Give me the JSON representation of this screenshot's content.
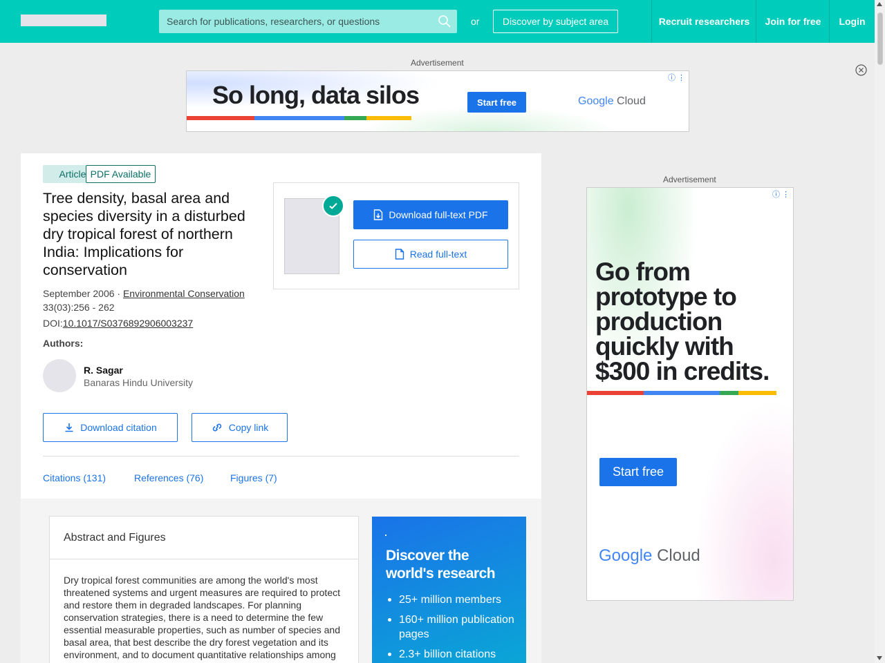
{
  "nav": {
    "search_placeholder": "Search for publications, researchers, or questions",
    "or_label": "or",
    "discover_label": "Discover by subject area",
    "links": [
      "Recruit researchers",
      "Join for free",
      "Login"
    ]
  },
  "ads": {
    "label": "Advertisement",
    "banner": {
      "headline": "So long, data silos",
      "cta": "Start free",
      "brand_google": "Google",
      "brand_cloud": "Cloud"
    },
    "side": {
      "headline": "Go from prototype to production quickly with $300 in credits.",
      "cta": "Start free",
      "brand_google": "Google",
      "brand_cloud": "Cloud"
    }
  },
  "article": {
    "type_badge": "Article",
    "pdf_badge": "PDF Available",
    "title": "Tree density, basal area and species diversity in a disturbed dry tropical forest of northern India: Implications for conservation",
    "date": "September 2006 · ",
    "journal": "Environmental Conservation",
    "volume": "33(03):256 - 262",
    "doi_label": "DOI:",
    "doi": "10.1017/S0376892906003237",
    "authors_label": "Authors:",
    "authors": [
      {
        "name": "R. Sagar",
        "affiliation": "Banaras Hindu University"
      }
    ],
    "actions": {
      "download_pdf": "Download full-text PDF",
      "read_fulltext": "Read full-text",
      "download_citation": "Download citation",
      "copy_link": "Copy link"
    },
    "tabs": [
      "Citations (131)",
      "References (76)",
      "Figures (7)"
    ]
  },
  "abstract": {
    "heading": "Abstract and Figures",
    "text": "Dry tropical forest communities are among the world's most threatened systems and urgent measures are required to protect and restore them in degraded landscapes. For planning conservation strategies, there is a need to determine the few essential measurable properties, such as number of species and basal area, that best describe the dry forest vegetation and its environment, and to document quantitative relationships among"
  },
  "promo": {
    "title": "Discover the world's research",
    "items": [
      "25+ million members",
      "160+ million publication pages",
      "2.3+ billion citations"
    ]
  },
  "colors": {
    "brand": "#00ccbb",
    "accent": "#1a73e8",
    "badge_text": "#0b6f66"
  }
}
